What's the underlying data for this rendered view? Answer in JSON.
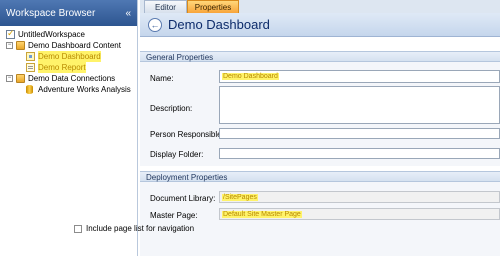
{
  "workspace_browser": {
    "title": "Workspace Browser",
    "collapse_glyph": "«",
    "tree": [
      {
        "label": "UntitledWorkspace",
        "icon": "workspace-icon",
        "level": 0,
        "toggle": "",
        "highlighted": false
      },
      {
        "label": "Demo Dashboard Content",
        "icon": "folder-icon",
        "level": 1,
        "toggle": "−",
        "highlighted": false
      },
      {
        "label": "Demo Dashboard",
        "icon": "dashboard-icon",
        "level": 2,
        "toggle": "",
        "highlighted": true
      },
      {
        "label": "Demo Report",
        "icon": "report-icon",
        "level": 2,
        "toggle": "",
        "highlighted": true
      },
      {
        "label": "Demo Data Connections",
        "icon": "folder-icon",
        "level": 1,
        "toggle": "−",
        "highlighted": false
      },
      {
        "label": "Adventure Works Analysis",
        "icon": "database-icon",
        "level": 2,
        "toggle": "",
        "highlighted": false
      }
    ]
  },
  "tabs": {
    "editor": "Editor",
    "properties": "Properties",
    "active": "Properties"
  },
  "page": {
    "back_glyph": "←",
    "title": "Demo Dashboard"
  },
  "general": {
    "header": "General Properties",
    "name_label": "Name:",
    "name_value": "Demo Dashboard",
    "description_label": "Description:",
    "person_label": "Person Responsible:",
    "folder_label": "Display Folder:"
  },
  "deployment": {
    "header": "Deployment Properties",
    "library_label": "Document Library:",
    "library_value": "/SitePages",
    "master_label": "Master Page:",
    "master_value": "Default Site Master Page",
    "include_label": "Include page list for navigation",
    "include_checked": false
  },
  "colors": {
    "highlight": "#fff36a",
    "header_blue": "#2d5590",
    "active_tab": "#f8a53b"
  }
}
